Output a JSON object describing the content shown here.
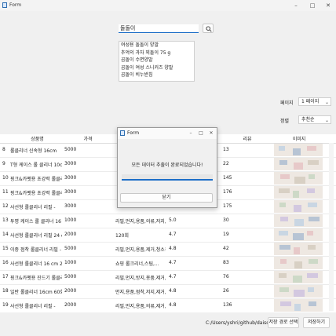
{
  "window": {
    "title": "Form",
    "minimize": "–",
    "maximize": "□",
    "close": "✕"
  },
  "search": {
    "value": "돌돌이",
    "button_icon": "search-icon"
  },
  "suggestions": [
    "여성용 돌돌이 양말",
    "추억의 과자 꾀돌이 75 g",
    "곰돌이 수면양말",
    "곰돌이 여성 스니커즈 양말",
    "곰돌이 비누받침"
  ],
  "page": {
    "label": "페이지",
    "value": "1 페이지"
  },
  "sort": {
    "label": "정렬",
    "value": "추천순"
  },
  "table": {
    "headers": [
      "상품명",
      "가격",
      "",
      "",
      "리뷰",
      "이미지"
    ],
    "rows": [
      {
        "no": "8",
        "name": "롤클리너 신속형 16cm",
        "price": "5000",
        "category": "",
        "rating": "",
        "reviews": "13"
      },
      {
        "no": "9",
        "name": "T형 케이스 롤 클리너 10cm-...",
        "price": "3000",
        "category": "",
        "rating": "",
        "reviews": "22"
      },
      {
        "no": "10",
        "name": "핑크&카펫용 초강력 롤클리...",
        "price": "3000",
        "category": "",
        "rating": "",
        "reviews": "145"
      },
      {
        "no": "11",
        "name": "핑크&카펫용 초강력 롤클리너",
        "price": "3000",
        "category": "",
        "rating": "",
        "reviews": "176"
      },
      {
        "no": "12",
        "name": "사선형 롤클리너 리필 -",
        "price": "3000",
        "category": "",
        "rating": "",
        "reviews": "175"
      },
      {
        "no": "13",
        "name": "투명 케이스 롤 클리너 16 c...",
        "price": "1000",
        "category": "리필,먼지,용품,의류,저지,제...",
        "rating": "5.0",
        "reviews": "30"
      },
      {
        "no": "14",
        "name": "사선형 롤클리너 리필 24 c...",
        "price": "2000",
        "category": "120회",
        "rating": "4.7",
        "reviews": "19"
      },
      {
        "no": "15",
        "name": "이중 점착 롤클리너 리필 -",
        "price": "5000",
        "category": "리필,먼지,용품,제거,청소용...",
        "rating": "4.8",
        "reviews": "42"
      },
      {
        "no": "16",
        "name": "사선형 롤클리너 16 cm 20회",
        "price": "1000",
        "category": "쇼핑 롤크리너,스팀,...",
        "rating": "4.7",
        "reviews": "83"
      },
      {
        "no": "17",
        "name": "핑크&카펫용 진드기 롤클리...",
        "price": "5000",
        "category": "리필,먼지,방지,용품,제거,청...",
        "rating": "4.7",
        "reviews": "76"
      },
      {
        "no": "18",
        "name": "일반 롤클리너 16cm 60회 -",
        "price": "2000",
        "category": "먼지,용품,점착,저지,제거,청...",
        "rating": "4.8",
        "reviews": "26"
      },
      {
        "no": "19",
        "name": "사선형 롤클리너 리필 -",
        "price": "2000",
        "category": "리필,먼지,용품,의류,제거,청...",
        "rating": "4.8",
        "reviews": "136"
      }
    ]
  },
  "footer": {
    "path": "C:/Users/yshri/github/daiso",
    "save_path_button": "저장 경로 선택",
    "save_button": "저장하기"
  },
  "dialog": {
    "title": "Form",
    "message": "모든 데이터 추출이 완료되었습니다!",
    "close_button": "닫기",
    "progress": 1.0,
    "minimize": "–",
    "maximize": "□",
    "close": "✕"
  },
  "colors": {
    "accent": "#1e6fc8"
  }
}
